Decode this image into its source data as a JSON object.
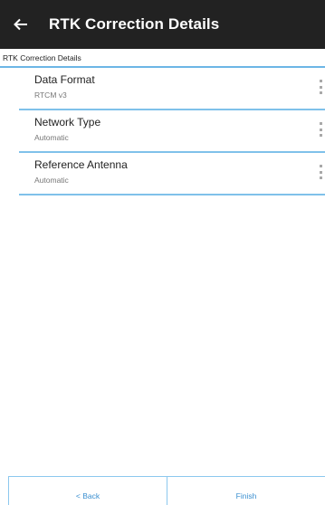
{
  "header": {
    "title": "RTK Correction Details",
    "back_icon": "arrow-left-icon"
  },
  "section": {
    "title": "RTK Correction Details"
  },
  "rows": [
    {
      "label": "Data Format",
      "value": "RTCM v3"
    },
    {
      "label": "Network Type",
      "value": "Automatic"
    },
    {
      "label": "Reference Antenna",
      "value": "Automatic"
    }
  ],
  "footer": {
    "back_label": "< Back",
    "finish_label": "Finish"
  },
  "colors": {
    "header_bg": "#222222",
    "accent_line": "#6cb6e6",
    "button_text": "#3a8fd0"
  }
}
